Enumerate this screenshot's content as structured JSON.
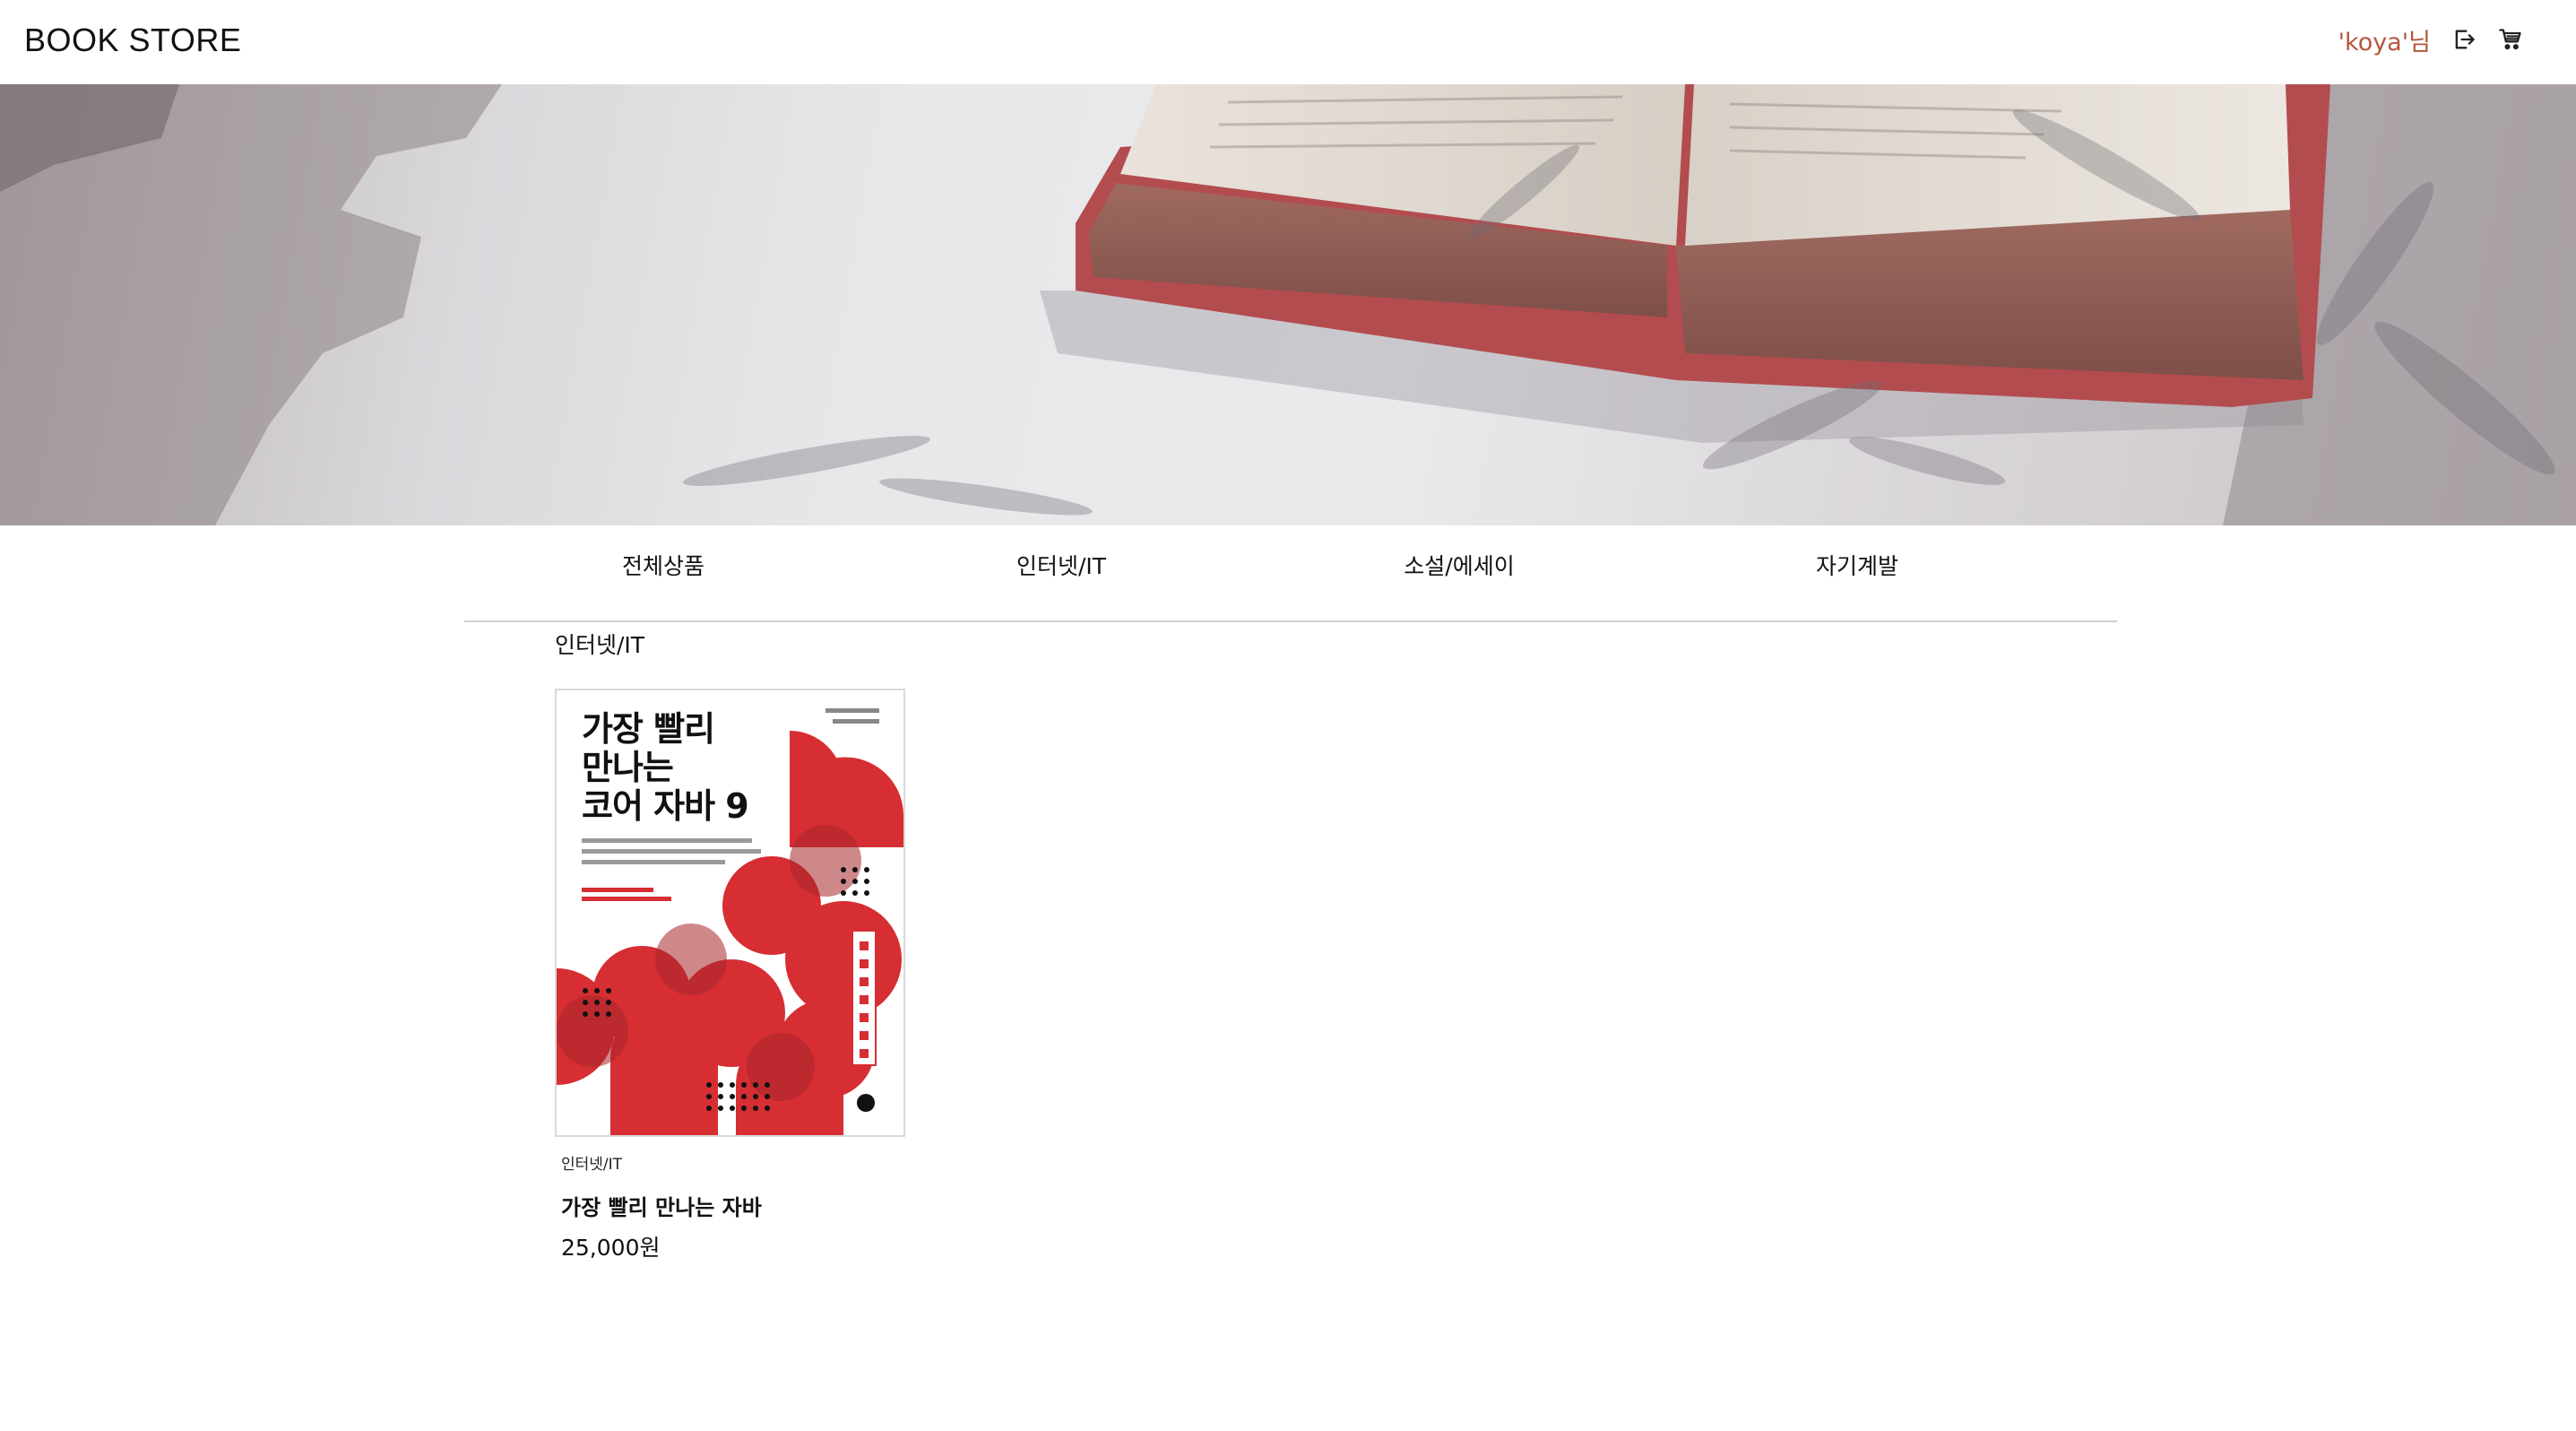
{
  "header": {
    "logo": "BOOK STORE",
    "greeting": "'koya'님",
    "icons": [
      "logout-icon",
      "cart-icon"
    ]
  },
  "hero": {
    "image": "open-book-on-table-with-leaf-shadows"
  },
  "nav": {
    "items": [
      {
        "label": "전체상품"
      },
      {
        "label": "인터넷/IT"
      },
      {
        "label": "소설/에세이"
      },
      {
        "label": "자기계발"
      }
    ]
  },
  "section": {
    "title": "인터넷/IT"
  },
  "products": [
    {
      "category": "인터넷/IT",
      "title": "가장 빨리 만나는 자바",
      "price": "25,000원",
      "cover": {
        "line1": "가장 빨리",
        "line2": "만나는",
        "line3": "코어 자바 9"
      }
    }
  ],
  "colors": {
    "accent": "#b4573a",
    "cover_red": "#d62e33",
    "divider": "#cfcfcf"
  }
}
